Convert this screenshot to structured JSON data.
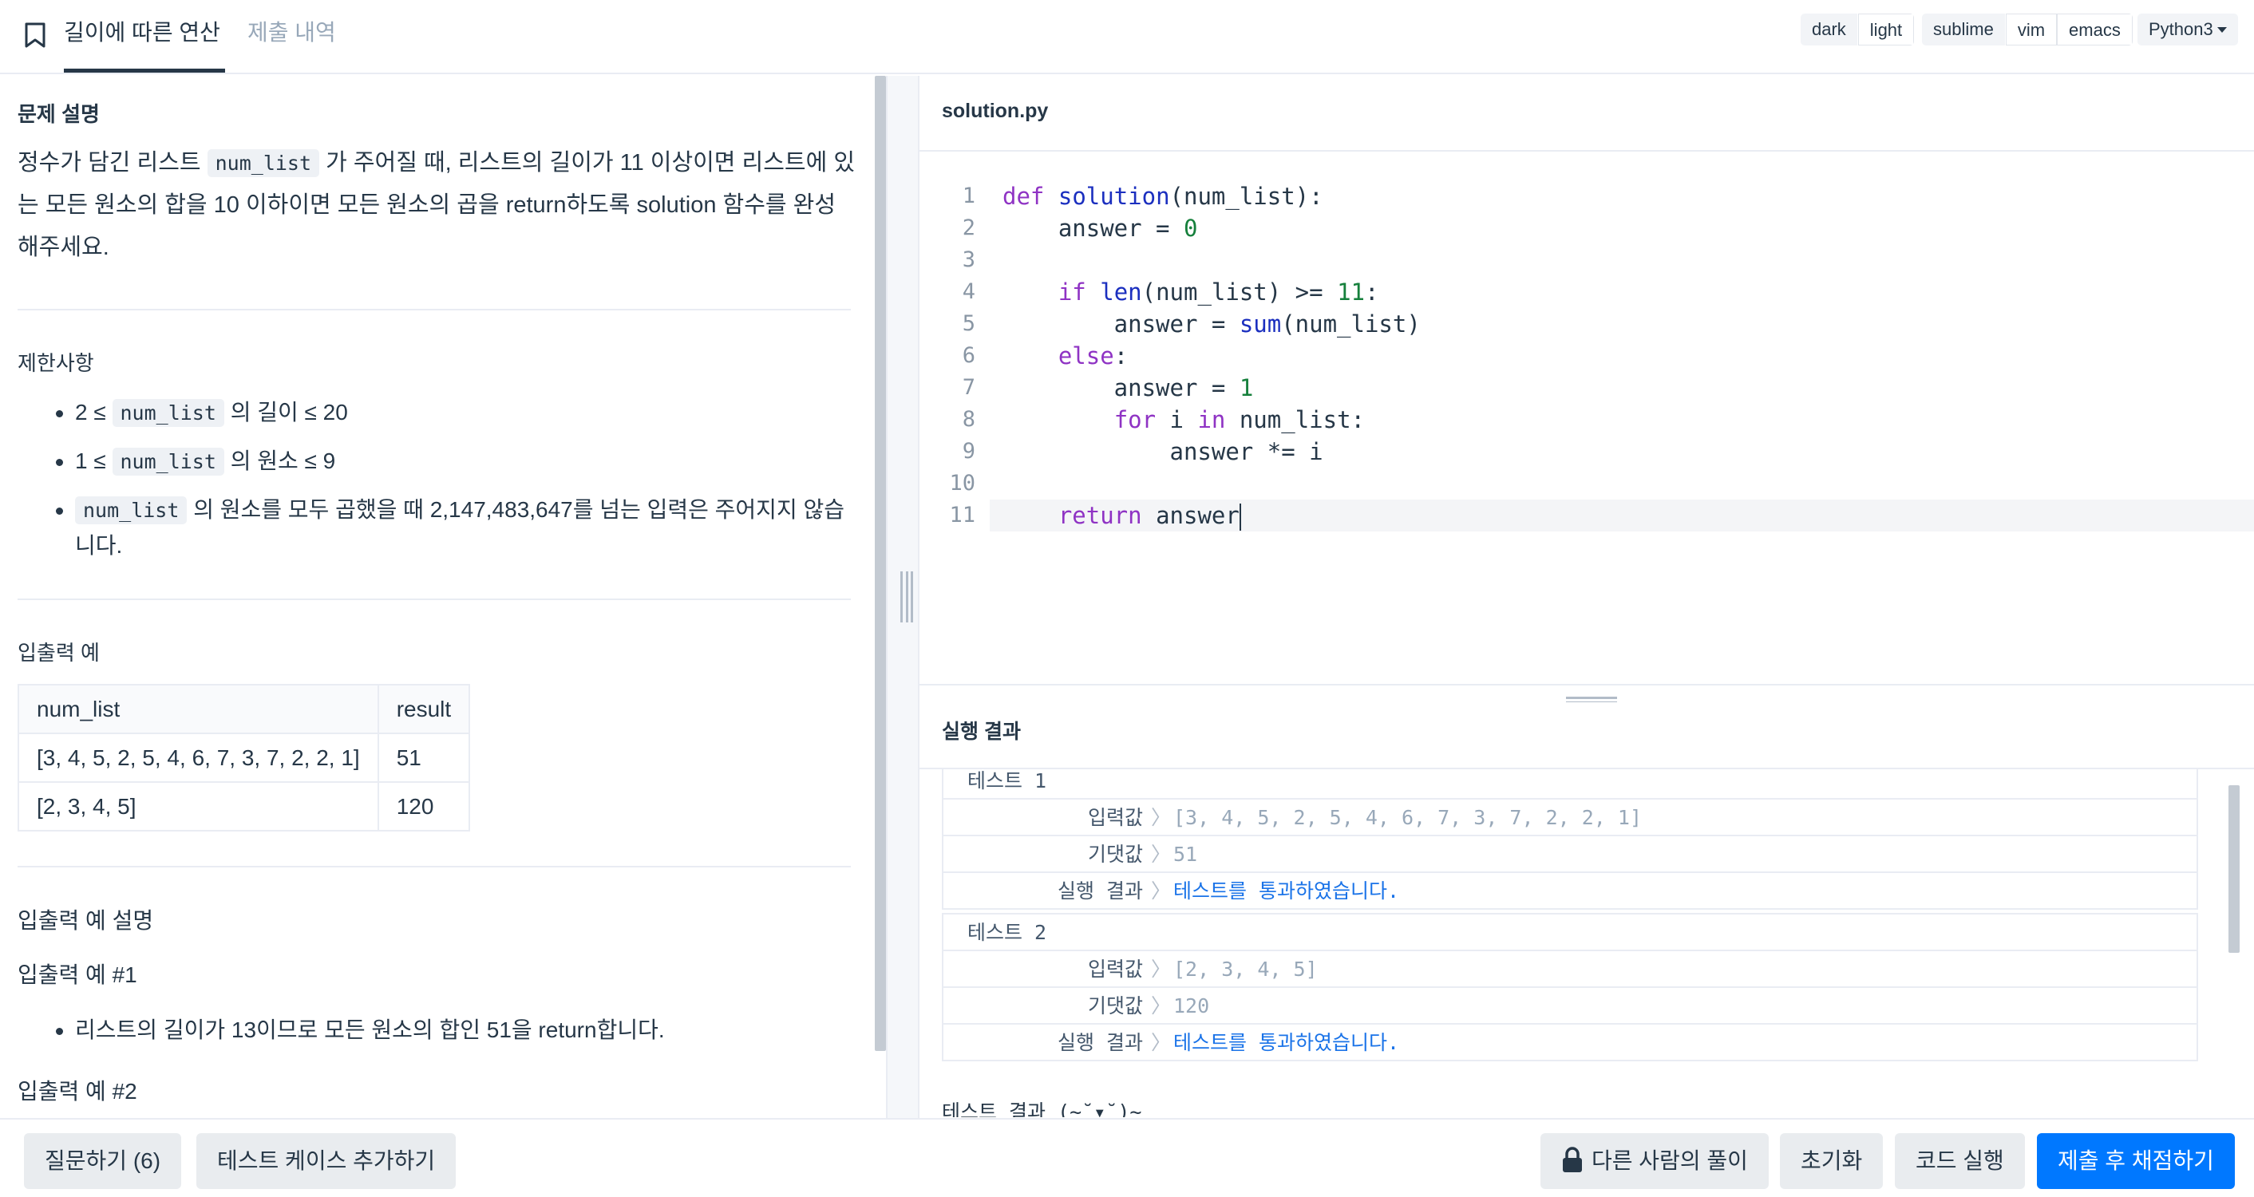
{
  "tabs": {
    "description": "길이에 따른 연산",
    "history": "제출 내역"
  },
  "toolbar": {
    "theme_options": [
      "dark",
      "light"
    ],
    "theme_selected": "light",
    "keymap_options": [
      "sublime",
      "vim",
      "emacs"
    ],
    "keymap_selected": "sublime",
    "language": "Python3"
  },
  "problem": {
    "section_description": "문제 설명",
    "desc_part1": "정수가 담긴 리스트 ",
    "desc_code": "num_list",
    "desc_part2": " 가 주어질 때, 리스트의 길이가 11 이상이면 리스트에 있는 모든 원소의 합을 10 이하이면 모든 원소의 곱을 return하도록 solution 함수를 완성해주세요.",
    "section_constraints": "제한사항",
    "constraints": [
      {
        "pre": "2 ≤ ",
        "code": "num_list",
        "post": " 의 길이 ≤ 20"
      },
      {
        "pre": "1 ≤ ",
        "code": "num_list",
        "post": " 의 원소 ≤ 9"
      },
      {
        "pre": "",
        "code": "num_list",
        "post": " 의 원소를 모두 곱했을 때 2,147,483,647를 넘는 입력은 주어지지 않습니다."
      }
    ],
    "section_examples": "입출력 예",
    "table_headers": [
      "num_list",
      "result"
    ],
    "table_rows": [
      [
        "[3, 4, 5, 2, 5, 4, 6, 7, 3, 7, 2, 2, 1]",
        "51"
      ],
      [
        "[2, 3, 4, 5]",
        "120"
      ]
    ],
    "section_example_explain": "입출력 예 설명",
    "example1_title": "입출력 예 #1",
    "example1_bullet": "리스트의 길이가 13이므로 모든 원소의 합인 51을 return합니다.",
    "example2_title": "입출력 예 #2"
  },
  "editor": {
    "filename": "solution.py",
    "line_numbers": [
      "1",
      "2",
      "3",
      "4",
      "5",
      "6",
      "7",
      "8",
      "9",
      "10",
      "11"
    ],
    "current_line": 11
  },
  "results": {
    "title": "실행 결과",
    "input_label": "입력값",
    "expected_label": "기댓값",
    "result_label": "실행 결과",
    "tests": [
      {
        "name": "테스트 1",
        "input": "[3, 4, 5, 2, 5, 4, 6, 7, 3, 7, 2, 2, 1]",
        "expected": "51",
        "result": "테스트를 통과하였습니다."
      },
      {
        "name": "테스트 2",
        "input": "[2, 3, 4, 5]",
        "expected": "120",
        "result": "테스트를 통과하였습니다."
      }
    ],
    "final_message": "테스트 결과 (~˘▾˘)~"
  },
  "bottom": {
    "ask_button": "질문하기 (6)",
    "add_testcase_button": "테스트 케이스 추가하기",
    "others_solution_button": "다른 사람의 풀이",
    "reset_button": "초기화",
    "run_button": "코드 실행",
    "submit_button": "제출 후 채점하기"
  },
  "colors": {
    "accent": "#0078ff",
    "text": "#263747",
    "pass": "#1a73e8"
  }
}
